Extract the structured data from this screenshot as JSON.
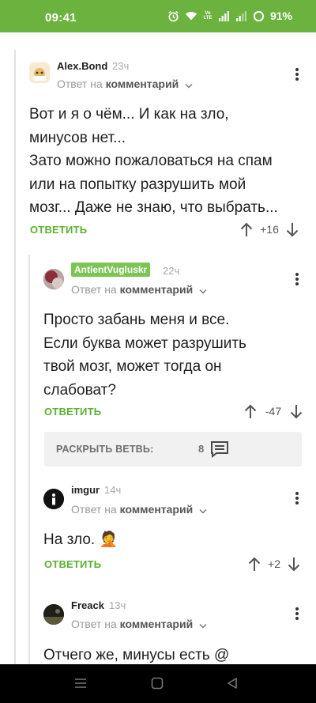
{
  "status_bar": {
    "time": "09:41",
    "battery_percent": "91%",
    "network_label": "Vo LTE",
    "icons": [
      "alarm-icon",
      "wifi-icon",
      "volte-icon",
      "signal-icon",
      "signal-icon",
      "battery-icon"
    ]
  },
  "colors": {
    "brand_green": "#6bb33e",
    "reply_green": "#5bb02f",
    "badge_green": "#7bc552"
  },
  "comments": [
    {
      "author": "Alex.Bond",
      "age": "23ч",
      "reply_prefix": "Ответ на",
      "reply_target": "комментарий",
      "body_lines": [
        "Вот и я о чём... И как на зло,",
        "минусов нет...",
        "Зато можно пожаловаться на спам",
        "или на попытку разрушить мой",
        "мозг... Даже не знаю, что выбрать..."
      ],
      "reply_label": "ОТВЕТИТЬ",
      "score": "+16"
    },
    {
      "author": "AntientVugluskr",
      "age": "22ч",
      "reply_prefix": "Ответ на",
      "reply_target": "комментарий",
      "body_lines": [
        "Просто забань меня и все.",
        "Если буква может разрушить",
        "твой мозг, может тогда он",
        "слабоват?"
      ],
      "reply_label": "ОТВЕТИТЬ",
      "score": "-47"
    },
    {
      "author": "imgur",
      "age": "14ч",
      "reply_prefix": "Ответ на",
      "reply_target": "комментарий",
      "body_lines": [
        "На зло. 🤦"
      ],
      "reply_label": "ОТВЕТИТЬ",
      "score": "+2"
    },
    {
      "author": "Freack",
      "age": "13ч",
      "reply_prefix": "Ответ на",
      "reply_target": "комментарий",
      "body_lines": [
        "Отчего же, минусы есть @"
      ]
    }
  ],
  "expand_branch": {
    "label": "РАСКРЫТЬ ВЕТВЬ:",
    "count": "8"
  },
  "nav_bar": {
    "buttons": [
      "recents-icon",
      "home-icon",
      "back-icon"
    ]
  }
}
